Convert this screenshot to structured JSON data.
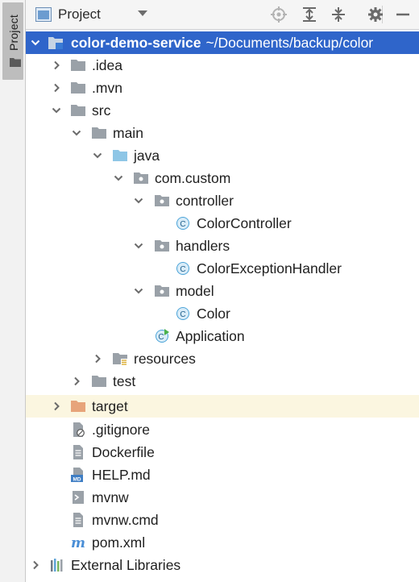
{
  "side_strip": {
    "tab_label": "Project"
  },
  "header": {
    "title": "Project"
  },
  "tree": {
    "root": {
      "label": "color-demo-service",
      "path": "~/Documents/backup/color"
    },
    "items": [
      {
        "label": ".idea"
      },
      {
        "label": ".mvn"
      },
      {
        "label": "src"
      },
      {
        "label": "main"
      },
      {
        "label": "java"
      },
      {
        "label": "com.custom"
      },
      {
        "label": "controller"
      },
      {
        "label": "ColorController"
      },
      {
        "label": "handlers"
      },
      {
        "label": "ColorExceptionHandler"
      },
      {
        "label": "model"
      },
      {
        "label": "Color"
      },
      {
        "label": "Application"
      },
      {
        "label": "resources"
      },
      {
        "label": "test"
      },
      {
        "label": "target"
      },
      {
        "label": ".gitignore"
      },
      {
        "label": "Dockerfile"
      },
      {
        "label": "HELP.md"
      },
      {
        "label": "mvnw"
      },
      {
        "label": "mvnw.cmd"
      },
      {
        "label": "pom.xml"
      },
      {
        "label": "External Libraries"
      }
    ]
  },
  "colors": {
    "selection": "#2f65ca",
    "folder": "#9aa1a8",
    "source_folder": "#8ec6e6",
    "excluded_folder": "#e7a47a",
    "excluded_row": "#fbf6e0",
    "class_icon": "#4aa3d8"
  }
}
